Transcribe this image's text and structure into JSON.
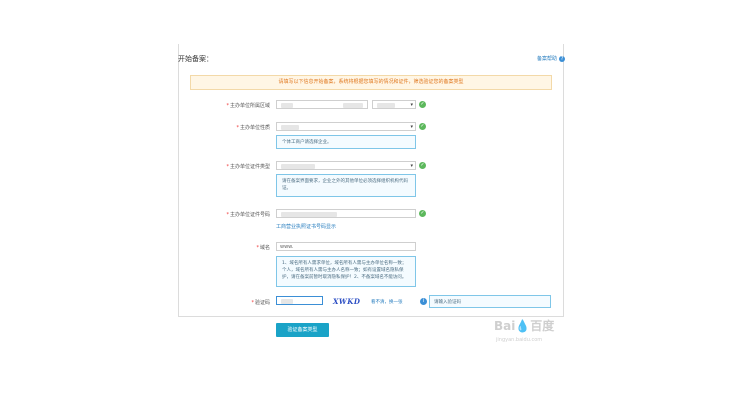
{
  "header": {
    "title": "开始备案：",
    "help_label": "备案帮助",
    "help_icon": "question-circle-icon"
  },
  "notice": "请填写以下信息开始备案，系统将根据您填写的情况和证件，筛选验证您的备案类型",
  "form": {
    "region_label": "主办单位所属区域",
    "nature_label": "主办单位性质",
    "nature_hint": "个体工商户请选择企业。",
    "cert_type_label": "主办单位证件类型",
    "cert_type_hint": "请在备案界面要求，企业之外的其他单位必须选择组织机构代码证。",
    "cert_no_label": "主办单位证件号码",
    "cert_no_link": "工商营业执照证书号码显示",
    "domain_label": "域名",
    "domain_value": "www.",
    "domain_hint": "1、域名所有人需求单位，域名所有人需与主办单位名称一致；个人，域名所有人需与主办人名称一致；如有设置域名隐私保护，请在备案前暂时取消隐私保护！2、不备案域名不能访问。",
    "captcha_label": "验证码",
    "captcha_text": "XWKD",
    "captcha_refresh": "看不清，换一张",
    "captcha_tip": "请输入验证码",
    "required_mark": "*"
  },
  "submit_label": "验证备案类型",
  "watermark": {
    "text": "Bai💧百度",
    "sub": "jingyan.baidu.com"
  },
  "colors": {
    "accent": "#1aa3c7",
    "ok": "#5cb85c",
    "notice": "#e0781f"
  }
}
